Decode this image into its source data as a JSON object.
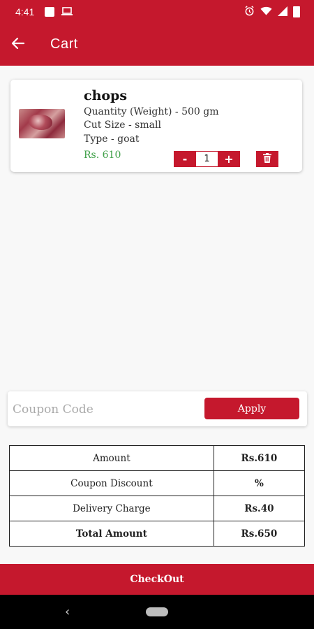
{
  "status_bar": {
    "time": "4:41"
  },
  "header": {
    "title": "Cart"
  },
  "cart_items": [
    {
      "name": "chops",
      "quantity_weight": "Quantity (Weight) - 500 gm",
      "cut_size": "Cut Size - small",
      "type": "Type - goat",
      "price": "Rs. 610",
      "qty": "1",
      "minus_label": "-",
      "plus_label": "+"
    }
  ],
  "coupon": {
    "placeholder": "Coupon Code",
    "apply_label": "Apply"
  },
  "summary": {
    "rows": [
      {
        "label": "Amount",
        "value": "Rs.610"
      },
      {
        "label": "Coupon Discount",
        "value": "%"
      },
      {
        "label": "Delivery Charge",
        "value": "Rs.40"
      },
      {
        "label": "Total Amount",
        "value": "Rs.650"
      }
    ]
  },
  "checkout_label": "CheckOut",
  "icons": {
    "back": "arrow-left-icon",
    "delete": "trash-icon",
    "alarm": "alarm-icon",
    "wifi": "wifi-icon",
    "signal": "signal-icon",
    "battery": "battery-icon"
  },
  "colors": {
    "primary": "#c5182d",
    "price": "#3fa048",
    "background": "#f8f8f8"
  }
}
